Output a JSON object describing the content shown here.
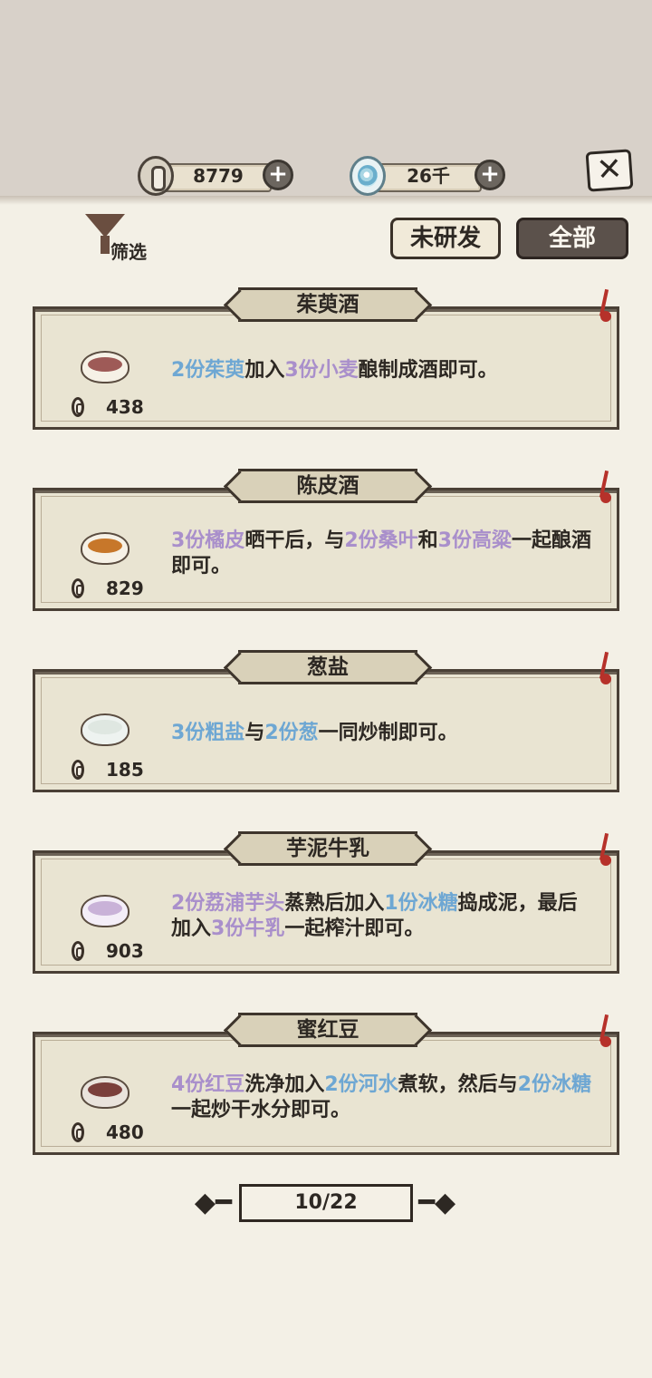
{
  "header": {
    "coins": "8779",
    "jade": "26千",
    "plus_icon": "plus-icon",
    "close_icon": "close-icon"
  },
  "toolbar": {
    "filter_label": "筛选",
    "tab_unresearched": "未研发",
    "tab_all": "全部"
  },
  "recipes": [
    {
      "name": "茱萸酒",
      "price": "438",
      "dish": "red-wine-cup",
      "desc": [
        [
          "2份茱萸",
          "b"
        ],
        [
          "加入",
          ""
        ],
        [
          "3份小麦",
          "p"
        ],
        [
          "酿制成酒即可。",
          ""
        ]
      ]
    },
    {
      "name": "陈皮酒",
      "price": "829",
      "dish": "amber-wine-bowl",
      "desc": [
        [
          "3份橘皮",
          "p"
        ],
        [
          "晒干后，与",
          ""
        ],
        [
          "2份桑叶",
          "p"
        ],
        [
          "和",
          ""
        ],
        [
          "3份高粱",
          "p"
        ],
        [
          "一起酿酒即可。",
          ""
        ]
      ]
    },
    {
      "name": "葱盐",
      "price": "185",
      "dish": "salt-bowl",
      "desc": [
        [
          "3份粗盐",
          "b"
        ],
        [
          "与",
          ""
        ],
        [
          "2份葱",
          "b"
        ],
        [
          "一同炒制即可。",
          ""
        ]
      ]
    },
    {
      "name": "芋泥牛乳",
      "price": "903",
      "dish": "taro-milk-cup",
      "desc": [
        [
          "2份荔浦芋头",
          "p"
        ],
        [
          "蒸熟后加入",
          ""
        ],
        [
          "1份冰糖",
          "b"
        ],
        [
          "捣成泥，最后加入",
          ""
        ],
        [
          "3份牛乳",
          "p"
        ],
        [
          "一起榨汁即可。",
          ""
        ]
      ]
    },
    {
      "name": "蜜红豆",
      "price": "480",
      "dish": "red-bean-bowl",
      "desc": [
        [
          "4份红豆",
          "p"
        ],
        [
          "洗净加入",
          ""
        ],
        [
          "2份河水",
          "b"
        ],
        [
          "煮软，然后与",
          ""
        ],
        [
          "2份冰糖",
          "b"
        ],
        [
          "一起炒干水分即可。",
          ""
        ]
      ]
    }
  ],
  "pager": {
    "current": "10/22"
  },
  "colors": {
    "blue_ingredient": "#6ea7d3",
    "purple_ingredient": "#a98fcb",
    "bookmark_red": "#b6312a"
  }
}
